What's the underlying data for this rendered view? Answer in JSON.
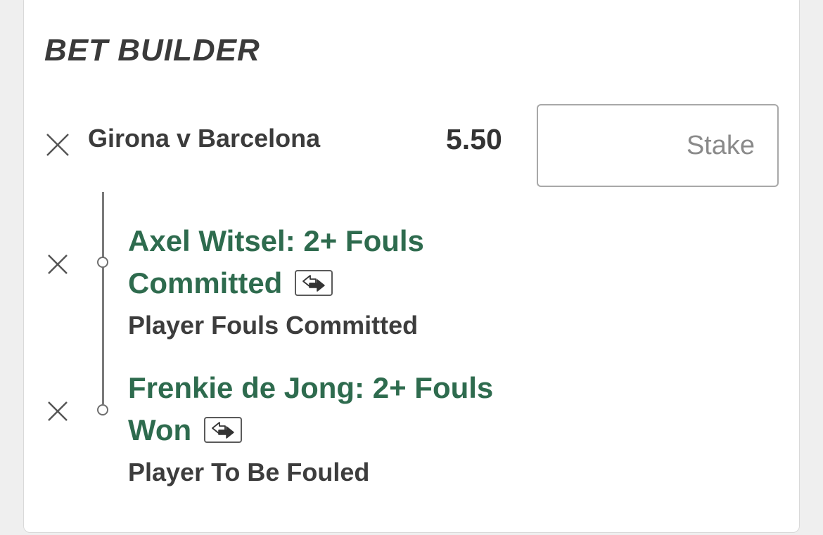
{
  "panel": {
    "title": "BET BUILDER"
  },
  "match": {
    "name": "Girona v Barcelona",
    "odds": "5.50",
    "stake_placeholder": "Stake"
  },
  "selections": [
    {
      "title_line1": "Axel Witsel: 2+ Fouls",
      "title_line2": "Committed",
      "market": "Player Fouls Committed"
    },
    {
      "title_line1": "Frenkie de Jong: 2+ Fouls",
      "title_line2": "Won",
      "market": "Player To Be Fouled"
    }
  ],
  "icons": {
    "remove": "close-icon",
    "swap": "swap-arrows-icon"
  },
  "colors": {
    "selection_green": "#2e6b4e",
    "text_dark": "#3b3b3b"
  }
}
